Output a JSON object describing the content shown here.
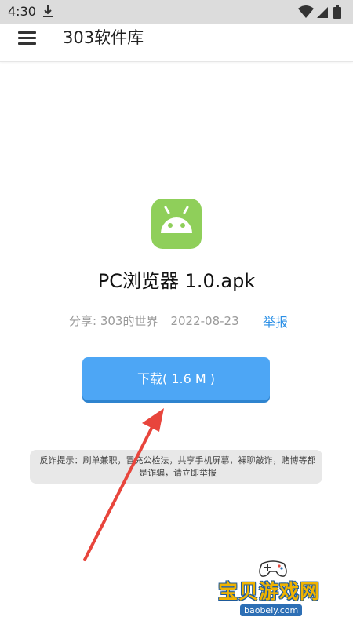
{
  "status_bar": {
    "time": "4:30"
  },
  "app_bar": {
    "title": "303软件库"
  },
  "file": {
    "name": "PC浏览器 1.0.apk",
    "shared_by": "分享: 303的世界",
    "date": "2022-08-23",
    "report_label": "举报",
    "download_label": "下载( 1.6 M )"
  },
  "warning": {
    "text": "反诈提示：刷单兼职，冒充公检法，共享手机屏幕，裸聊敲诈，赌博等都是诈骗，请立即举报"
  },
  "watermark": {
    "title": "宝贝游戏网",
    "url": "baobeiy.com"
  },
  "colors": {
    "accent": "#4da6f5",
    "link": "#2a8fe6",
    "app_icon": "#8fcf5a",
    "arrow": "#e8453c"
  },
  "icons": {
    "status_left": "download-icon",
    "status_right": [
      "wifi-icon",
      "signal-icon",
      "battery-icon"
    ],
    "menu": "hamburger-menu-icon",
    "app": "android-icon"
  }
}
